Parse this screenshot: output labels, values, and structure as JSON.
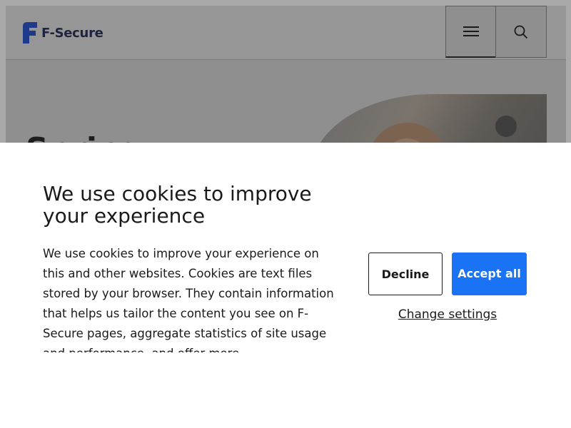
{
  "header": {
    "logo_text": "F-Secure",
    "menu_icon": "hamburger-menu-icon",
    "search_icon": "search-icon",
    "brand_color": "#1e2440"
  },
  "hero": {
    "title_partial": "Spring"
  },
  "cookie_banner": {
    "title": "We use cookies to improve your experience",
    "body": "We use cookies to improve your experience on this and other websites. Cookies are text files stored by your browser. They contain information that helps us tailor the content you see on F-Secure pages, aggregate statistics of site usage and performance, and offer more",
    "decline_label": "Decline",
    "accept_label": "Accept all",
    "settings_link": "Change settings",
    "accent_color": "#1a73f5"
  }
}
